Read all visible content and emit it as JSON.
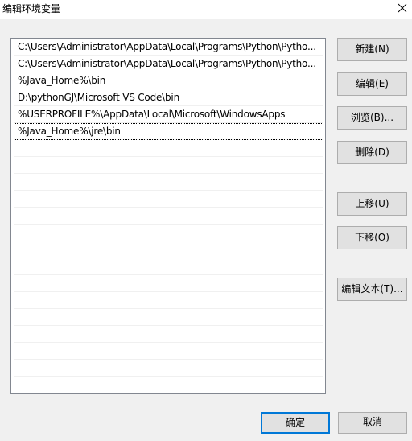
{
  "window": {
    "title": "编辑环境变量",
    "close_icon": "close-icon"
  },
  "paths": [
    "C:\\Users\\Administrator\\AppData\\Local\\Programs\\Python\\Pytho...",
    "C:\\Users\\Administrator\\AppData\\Local\\Programs\\Python\\Pytho...",
    "%Java_Home%\\bin",
    "D:\\pythonGJ\\Microsoft VS Code\\bin",
    "%USERPROFILE%\\AppData\\Local\\Microsoft\\WindowsApps",
    "%Java_Home%\\jre\\bin",
    "",
    "",
    "",
    "",
    "",
    "",
    "",
    "",
    "",
    "",
    "",
    "",
    "",
    "",
    ""
  ],
  "buttons": {
    "new": "新建(N)",
    "edit": "编辑(E)",
    "browse": "浏览(B)...",
    "delete": "删除(D)",
    "move_up": "上移(U)",
    "move_down": "下移(O)",
    "edit_text": "编辑文本(T)...",
    "ok": "确定",
    "cancel": "取消"
  },
  "colors": {
    "default_button_border": "#0078d7"
  }
}
